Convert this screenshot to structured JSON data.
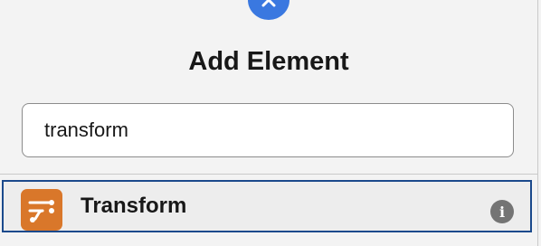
{
  "dialog": {
    "title": "Add Element",
    "close_icon": "close-icon"
  },
  "search": {
    "value": "transform",
    "placeholder": ""
  },
  "results": [
    {
      "label": "Transform",
      "icon": "transform-icon",
      "icon_color": "#d9772a",
      "info_icon": "info-icon",
      "selected": true
    }
  ],
  "colors": {
    "accent": "#3a78e0",
    "selection_border": "#1b4a8c"
  }
}
